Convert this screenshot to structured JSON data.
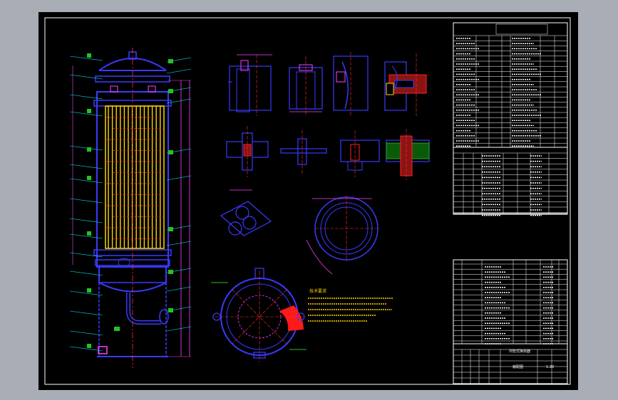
{
  "app": {
    "viewport_color": "#a9adb5",
    "sheet_color": "#000000"
  },
  "palette": {
    "frame": "#ffffff",
    "outline": "#3a3aff",
    "center_line": "#ff3030",
    "dimension": "#ff40ff",
    "leader": "#00e5ff",
    "tube": "#ffd400",
    "tag_fill": "#22c422",
    "hatch": "#ff2020"
  },
  "title_block": {
    "project_line": "列管式换热器",
    "drawing_name": "装配图",
    "scale": "1:20"
  },
  "technical_notes": {
    "heading": "技术要求"
  }
}
